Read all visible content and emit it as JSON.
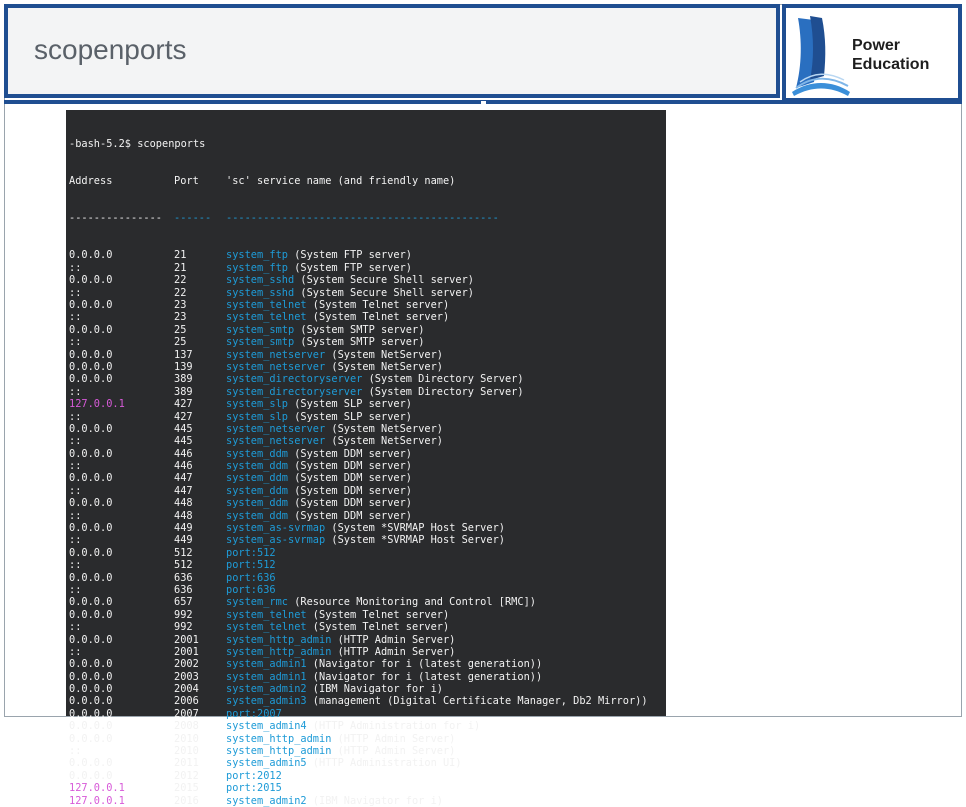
{
  "slide": {
    "title": "scopenports"
  },
  "logo": {
    "line1": "Power",
    "line2": "Education"
  },
  "colors": {
    "accent": "#1f4e91",
    "terminal_bg": "#2a2b2d",
    "service_name": "#1e9bd7",
    "loopback": "#d75ad8"
  },
  "terminal": {
    "prompt": "-bash-5.2$ scopenports",
    "header": {
      "address": "Address",
      "port": "Port",
      "service": "'sc' service name (and friendly name)"
    },
    "separator": {
      "address": "---------------",
      "port": "------",
      "service": "--------------------------------------------"
    },
    "rows": [
      {
        "address": "0.0.0.0",
        "port": "21",
        "service": "system_ftp",
        "friendly": " (System FTP server)"
      },
      {
        "address": "::",
        "port": "21",
        "service": "system_ftp",
        "friendly": " (System FTP server)"
      },
      {
        "address": "0.0.0.0",
        "port": "22",
        "service": "system_sshd",
        "friendly": " (System Secure Shell server)"
      },
      {
        "address": "::",
        "port": "22",
        "service": "system_sshd",
        "friendly": " (System Secure Shell server)"
      },
      {
        "address": "0.0.0.0",
        "port": "23",
        "service": "system_telnet",
        "friendly": " (System Telnet server)"
      },
      {
        "address": "::",
        "port": "23",
        "service": "system_telnet",
        "friendly": " (System Telnet server)"
      },
      {
        "address": "0.0.0.0",
        "port": "25",
        "service": "system_smtp",
        "friendly": " (System SMTP server)"
      },
      {
        "address": "::",
        "port": "25",
        "service": "system_smtp",
        "friendly": " (System SMTP server)"
      },
      {
        "address": "0.0.0.0",
        "port": "137",
        "service": "system_netserver",
        "friendly": " (System NetServer)"
      },
      {
        "address": "0.0.0.0",
        "port": "139",
        "service": "system_netserver",
        "friendly": " (System NetServer)"
      },
      {
        "address": "0.0.0.0",
        "port": "389",
        "service": "system_directoryserver",
        "friendly": " (System Directory Server)"
      },
      {
        "address": "::",
        "port": "389",
        "service": "system_directoryserver",
        "friendly": " (System Directory Server)"
      },
      {
        "address": "127.0.0.1",
        "port": "427",
        "service": "system_slp",
        "friendly": " (System SLP server)"
      },
      {
        "address": "::",
        "port": "427",
        "service": "system_slp",
        "friendly": " (System SLP server)"
      },
      {
        "address": "0.0.0.0",
        "port": "445",
        "service": "system_netserver",
        "friendly": " (System NetServer)"
      },
      {
        "address": "::",
        "port": "445",
        "service": "system_netserver",
        "friendly": " (System NetServer)"
      },
      {
        "address": "0.0.0.0",
        "port": "446",
        "service": "system_ddm",
        "friendly": " (System DDM server)"
      },
      {
        "address": "::",
        "port": "446",
        "service": "system_ddm",
        "friendly": " (System DDM server)"
      },
      {
        "address": "0.0.0.0",
        "port": "447",
        "service": "system_ddm",
        "friendly": " (System DDM server)"
      },
      {
        "address": "::",
        "port": "447",
        "service": "system_ddm",
        "friendly": " (System DDM server)"
      },
      {
        "address": "0.0.0.0",
        "port": "448",
        "service": "system_ddm",
        "friendly": " (System DDM server)"
      },
      {
        "address": "::",
        "port": "448",
        "service": "system_ddm",
        "friendly": " (System DDM server)"
      },
      {
        "address": "0.0.0.0",
        "port": "449",
        "service": "system_as-svrmap",
        "friendly": " (System *SVRMAP Host Server)"
      },
      {
        "address": "::",
        "port": "449",
        "service": "system_as-svrmap",
        "friendly": " (System *SVRMAP Host Server)"
      },
      {
        "address": "0.0.0.0",
        "port": "512",
        "service": "port:512",
        "friendly": ""
      },
      {
        "address": "::",
        "port": "512",
        "service": "port:512",
        "friendly": ""
      },
      {
        "address": "0.0.0.0",
        "port": "636",
        "service": "port:636",
        "friendly": ""
      },
      {
        "address": "::",
        "port": "636",
        "service": "port:636",
        "friendly": ""
      },
      {
        "address": "0.0.0.0",
        "port": "657",
        "service": "system_rmc",
        "friendly": " (Resource Monitoring and Control [RMC])"
      },
      {
        "address": "0.0.0.0",
        "port": "992",
        "service": "system_telnet",
        "friendly": " (System Telnet server)"
      },
      {
        "address": "::",
        "port": "992",
        "service": "system_telnet",
        "friendly": " (System Telnet server)"
      },
      {
        "address": "0.0.0.0",
        "port": "2001",
        "service": "system_http_admin",
        "friendly": " (HTTP Admin Server)"
      },
      {
        "address": "::",
        "port": "2001",
        "service": "system_http_admin",
        "friendly": " (HTTP Admin Server)"
      },
      {
        "address": "0.0.0.0",
        "port": "2002",
        "service": "system_admin1",
        "friendly": " (Navigator for i (latest generation))"
      },
      {
        "address": "0.0.0.0",
        "port": "2003",
        "service": "system_admin1",
        "friendly": " (Navigator for i (latest generation))"
      },
      {
        "address": "0.0.0.0",
        "port": "2004",
        "service": "system_admin2",
        "friendly": " (IBM Navigator for i)"
      },
      {
        "address": "0.0.0.0",
        "port": "2006",
        "service": "system_admin3",
        "friendly": " (management (Digital Certificate Manager, Db2 Mirror))"
      },
      {
        "address": "0.0.0.0",
        "port": "2007",
        "service": "port:2007",
        "friendly": ""
      },
      {
        "address": "0.0.0.0",
        "port": "2008",
        "service": "system_admin4",
        "friendly": " (HTTP Administration for i)"
      },
      {
        "address": "0.0.0.0",
        "port": "2010",
        "service": "system_http_admin",
        "friendly": " (HTTP Admin Server)"
      },
      {
        "address": "::",
        "port": "2010",
        "service": "system_http_admin",
        "friendly": " (HTTP Admin Server)"
      },
      {
        "address": "0.0.0.0",
        "port": "2011",
        "service": "system_admin5",
        "friendly": " (HTTP Administration UI)"
      },
      {
        "address": "0.0.0.0",
        "port": "2012",
        "service": "port:2012",
        "friendly": ""
      },
      {
        "address": "127.0.0.1",
        "port": "2015",
        "service": "port:2015",
        "friendly": ""
      },
      {
        "address": "127.0.0.1",
        "port": "2016",
        "service": "system_admin2",
        "friendly": " (IBM Navigator for i)"
      }
    ]
  }
}
